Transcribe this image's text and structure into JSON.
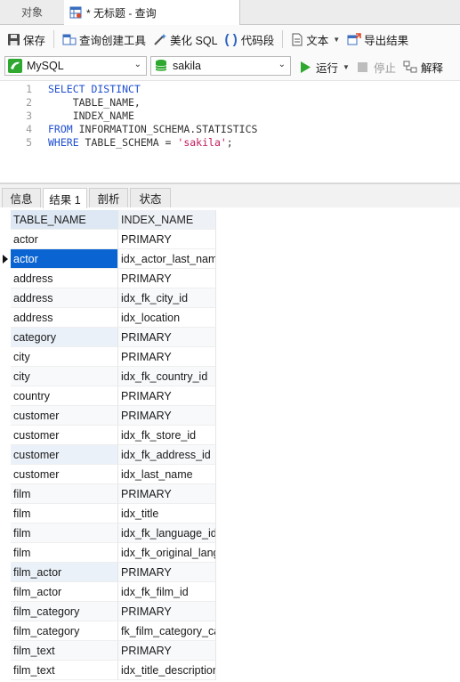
{
  "tabs": {
    "objects": "对象",
    "query": "* 无标题 - 查询"
  },
  "toolbar": {
    "save": "保存",
    "query_builder": "查询创建工具",
    "beautify": "美化 SQL",
    "snippet": "代码段",
    "text": "文本",
    "export": "导出结果"
  },
  "connection": {
    "type": "MySQL",
    "database": "sakila",
    "run": "运行",
    "stop": "停止",
    "explain": "解释"
  },
  "editor": {
    "lines": [
      {
        "num": "1",
        "parts": [
          {
            "t": "SELECT DISTINCT",
            "k": "kw"
          }
        ]
      },
      {
        "num": "2",
        "parts": [
          {
            "t": "    TABLE_NAME,",
            "k": ""
          }
        ]
      },
      {
        "num": "3",
        "parts": [
          {
            "t": "    INDEX_NAME",
            "k": ""
          }
        ]
      },
      {
        "num": "4",
        "parts": [
          {
            "t": "FROM",
            "k": "kw"
          },
          {
            "t": " INFORMATION_SCHEMA.STATISTICS",
            "k": ""
          }
        ]
      },
      {
        "num": "5",
        "parts": [
          {
            "t": "WHERE",
            "k": "kw"
          },
          {
            "t": " TABLE_SCHEMA = ",
            "k": ""
          },
          {
            "t": "'sakila'",
            "k": "str"
          },
          {
            "t": ";",
            "k": ""
          }
        ]
      }
    ]
  },
  "result_tabs": [
    "信息",
    "结果 1",
    "剖析",
    "状态"
  ],
  "grid": {
    "columns": [
      "TABLE_NAME",
      "INDEX_NAME"
    ],
    "rows": [
      [
        "actor",
        "PRIMARY"
      ],
      [
        "actor",
        "idx_actor_last_name"
      ],
      [
        "address",
        "PRIMARY"
      ],
      [
        "address",
        "idx_fk_city_id"
      ],
      [
        "address",
        "idx_location"
      ],
      [
        "category",
        "PRIMARY"
      ],
      [
        "city",
        "PRIMARY"
      ],
      [
        "city",
        "idx_fk_country_id"
      ],
      [
        "country",
        "PRIMARY"
      ],
      [
        "customer",
        "PRIMARY"
      ],
      [
        "customer",
        "idx_fk_store_id"
      ],
      [
        "customer",
        "idx_fk_address_id"
      ],
      [
        "customer",
        "idx_last_name"
      ],
      [
        "film",
        "PRIMARY"
      ],
      [
        "film",
        "idx_title"
      ],
      [
        "film",
        "idx_fk_language_id"
      ],
      [
        "film",
        "idx_fk_original_language_id"
      ],
      [
        "film_actor",
        "PRIMARY"
      ],
      [
        "film_actor",
        "idx_fk_film_id"
      ],
      [
        "film_category",
        "PRIMARY"
      ],
      [
        "film_category",
        "fk_film_category_category"
      ],
      [
        "film_text",
        "PRIMARY"
      ],
      [
        "film_text",
        "idx_title_description"
      ]
    ],
    "selected_row": 1,
    "highlighted_rows": [
      5,
      11,
      17
    ]
  },
  "colors": {
    "accent": "#0a64d2",
    "keyword": "#1f4fd1",
    "string": "#c2185b",
    "run": "#2fa82f"
  }
}
